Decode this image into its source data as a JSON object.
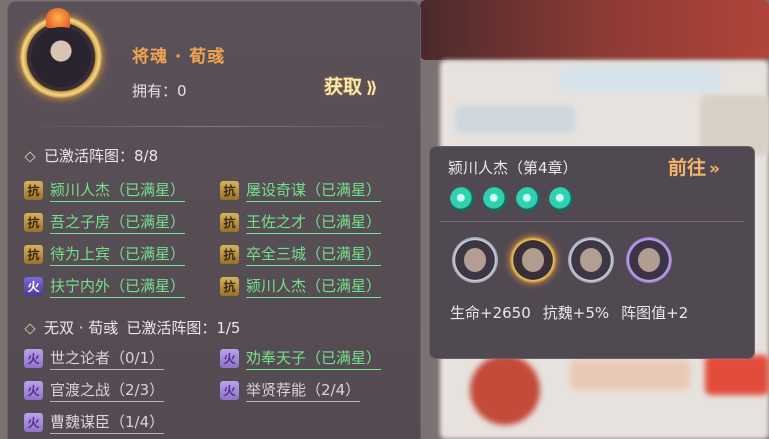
{
  "hero": {
    "name": "将魂 · 荀彧",
    "own_label": "拥有：",
    "own_count": "0",
    "obtain_label": "获取"
  },
  "activated": {
    "label": "已激活阵图：",
    "value": "8/8"
  },
  "activated_items": [
    {
      "badge": "抗",
      "badge_type": "kang",
      "text": "颍川人杰（已满星）"
    },
    {
      "badge": "抗",
      "badge_type": "kang",
      "text": "屡设奇谋（已满星）"
    },
    {
      "badge": "抗",
      "badge_type": "kang",
      "text": "吾之子房（已满星）"
    },
    {
      "badge": "抗",
      "badge_type": "kang",
      "text": "王佐之才（已满星）"
    },
    {
      "badge": "抗",
      "badge_type": "kang",
      "text": "待为上宾（已满星）"
    },
    {
      "badge": "抗",
      "badge_type": "kang",
      "text": "卒全三城（已满星）"
    },
    {
      "badge": "火",
      "badge_type": "huo",
      "text": "扶宁内外（已满星）"
    },
    {
      "badge": "抗",
      "badge_type": "kang",
      "text": "颍川人杰（已满星）"
    }
  ],
  "wushuang": {
    "title": "无双 · 荀彧",
    "label": "已激活阵图：",
    "value": "1/5"
  },
  "wushuang_items": [
    {
      "badge": "火",
      "text": "世之论者（0/1）",
      "style": "gray"
    },
    {
      "badge": "火",
      "text": "劝奉天子（已满星）",
      "style": "green"
    },
    {
      "badge": "火",
      "text": "官渡之战（2/3）",
      "style": "gray"
    },
    {
      "badge": "火",
      "text": "举贤荐能（2/4）",
      "style": "gray"
    },
    {
      "badge": "火",
      "text": "曹魏谋臣（1/4）",
      "style": "gray"
    }
  ],
  "detail": {
    "title": "颍川人杰（第4章）",
    "go_label": "前往",
    "star_count": 4,
    "bonuses": [
      "生命+2650",
      "抗魏+5%",
      "阵图值+2"
    ]
  },
  "colors": {
    "green_text": "#75e08a",
    "gold_text": "#f0a350",
    "go_text": "#f6b46a"
  },
  "icons": {
    "obtain_arrow": "double-chevron-right-icon",
    "go_arrow": "double-chevron-right-icon",
    "star": "teal-gem-icon"
  }
}
